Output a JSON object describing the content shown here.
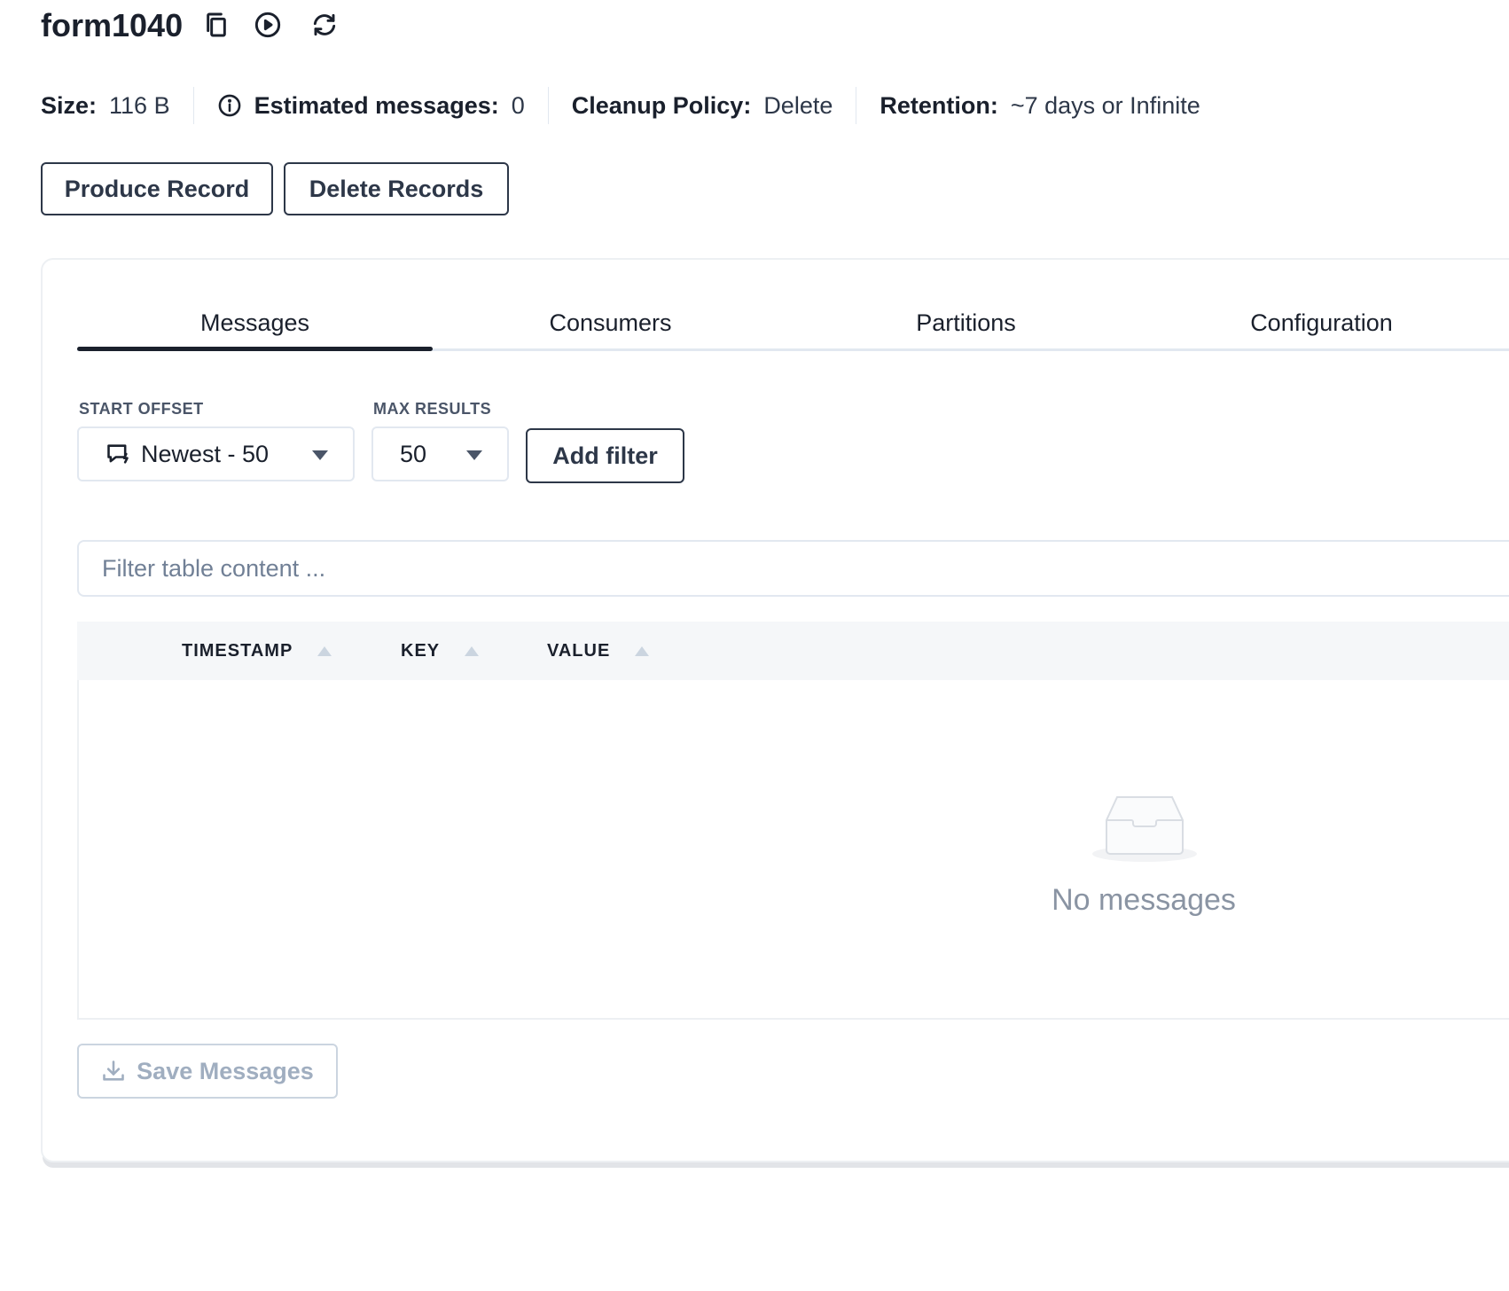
{
  "topic": {
    "name": "form1040"
  },
  "header_icons": [
    "copy-icon",
    "play-circle-icon",
    "refresh-icon"
  ],
  "stats": {
    "size_label": "Size:",
    "size_value": "116 B",
    "estimated_label": "Estimated messages:",
    "estimated_value": "0",
    "cleanup_label": "Cleanup Policy:",
    "cleanup_value": "Delete",
    "retention_label": "Retention:",
    "retention_value": "~7 days or Infinite"
  },
  "actions": {
    "produce": "Produce Record",
    "delete": "Delete Records"
  },
  "tabs": [
    {
      "label": "Messages",
      "active": true
    },
    {
      "label": "Consumers",
      "active": false
    },
    {
      "label": "Partitions",
      "active": false
    },
    {
      "label": "Configuration",
      "active": false
    }
  ],
  "controls": {
    "start_offset_label": "START OFFSET",
    "start_offset_value": "Newest - 50",
    "max_results_label": "MAX RESULTS",
    "max_results_value": "50",
    "add_filter": "Add filter"
  },
  "filter": {
    "placeholder": "Filter table content ..."
  },
  "table": {
    "columns": [
      "TIMESTAMP",
      "KEY",
      "VALUE"
    ],
    "rows": [],
    "empty_text": "No messages"
  },
  "footer": {
    "save_label": "Save Messages"
  },
  "colors": {
    "text": "#1a202c",
    "border": "#e2e8f0",
    "muted": "#a0aec0",
    "header_bg": "#f5f7f9"
  }
}
